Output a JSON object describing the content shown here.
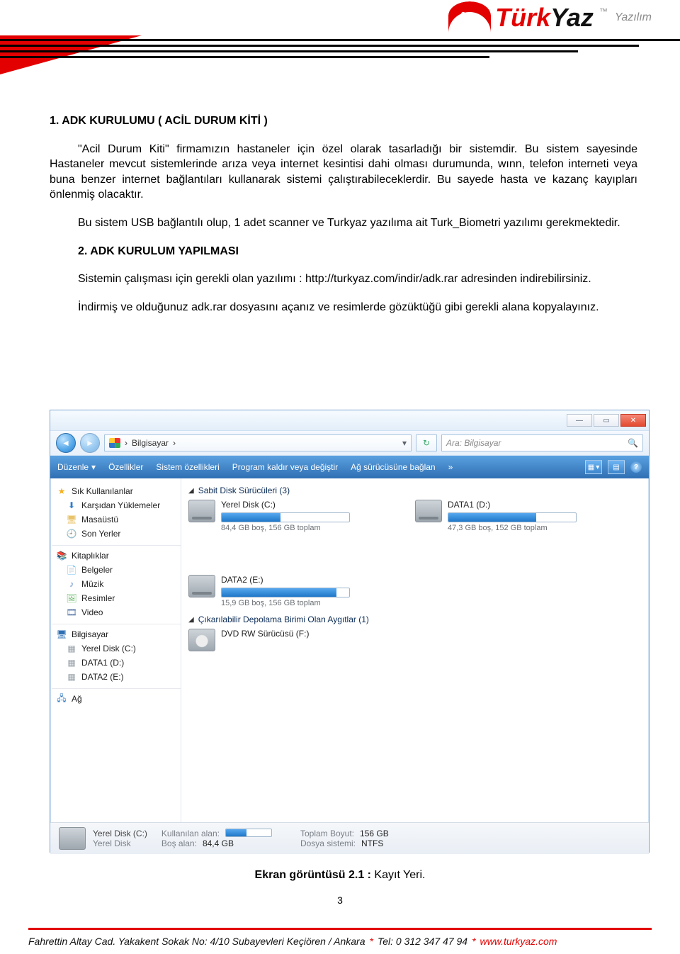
{
  "brand": {
    "part1": "Türk",
    "part2": "Yaz",
    "sub": "Yazılım"
  },
  "section1": {
    "title": "1.  ADK KURULUMU ( ACİL DURUM KİTİ )",
    "p1": "\"Acil Durum Kiti\" firmamızın hastaneler için özel olarak tasarladığı bir sistemdir. Bu sistem sayesinde Hastaneler mevcut sistemlerinde arıza veya internet kesintisi dahi olması durumunda, wınn, telefon interneti veya buna benzer internet bağlantıları kullanarak sistemi çalıştırabileceklerdir. Bu sayede hasta ve kazanç kayıpları önlenmiş olacaktır.",
    "p2": "Bu sistem USB bağlantılı olup, 1 adet scanner ve Turkyaz yazılıma ait Turk_Biometri yazılımı gerekmektedir."
  },
  "section2": {
    "title": "2.  ADK KURULUM YAPILMASI",
    "p1a": "Sistemin çalışması için gerekli olan yazılımı : ",
    "p1_link": "http://turkyaz.com/indir/adk.rar",
    "p1b": " adresinden indirebilirsiniz.",
    "p2": "İndirmiş ve olduğunuz adk.rar dosyasını açanız ve resimlerde gözüktüğü gibi gerekli alana kopyalayınız."
  },
  "explorer": {
    "breadcrumb": "Bilgisayar",
    "breadcrumb_sep": "›",
    "search_placeholder": "Ara: Bilgisayar",
    "toolbar": {
      "organize": "Düzenle",
      "properties": "Özellikler",
      "sysprops": "Sistem özellikleri",
      "uninstall": "Program kaldır veya değiştir",
      "mapdrive": "Ağ sürücüsüne bağlan",
      "more": "»"
    },
    "sidebar": {
      "favorites": "Sık Kullanılanlar",
      "downloads": "Karşıdan Yüklemeler",
      "desktop": "Masaüstü",
      "recent": "Son Yerler",
      "libraries": "Kitaplıklar",
      "documents": "Belgeler",
      "music": "Müzik",
      "pictures": "Resimler",
      "video": "Video",
      "computer": "Bilgisayar",
      "c": "Yerel Disk (C:)",
      "d": "DATA1 (D:)",
      "e": "DATA2 (E:)",
      "network": "Ağ"
    },
    "groups": {
      "hdd_header": "Sabit Disk Sürücüleri (3)",
      "removable_header": "Çıkarılabilir Depolama Birimi Olan Aygıtlar (1)"
    },
    "drives": {
      "c": {
        "name": "Yerel Disk (C:)",
        "sub": "84,4 GB boş, 156 GB toplam",
        "fill_pct": 46
      },
      "d": {
        "name": "DATA1 (D:)",
        "sub": "47,3 GB boş, 152 GB toplam",
        "fill_pct": 69
      },
      "e": {
        "name": "DATA2 (E:)",
        "sub": "15,9 GB boş, 156 GB toplam",
        "fill_pct": 90
      },
      "f": {
        "name": "DVD RW Sürücüsü (F:)"
      }
    },
    "status": {
      "title": "Yerel Disk (C:)",
      "type": "Yerel Disk",
      "used_label": "Kullanılan alan:",
      "free_label": "Boş alan:",
      "free_val": "84,4 GB",
      "total_label": "Toplam Boyut:",
      "total_val": "156 GB",
      "fs_label": "Dosya sistemi:",
      "fs_val": "NTFS",
      "mini_fill_pct": 46
    }
  },
  "caption": {
    "bold": "Ekran görüntüsü 2.1 :",
    "rest": " Kayıt Yeri."
  },
  "page_number": "3",
  "footer": {
    "addr": "Fahrettin Altay Cad. Yakakent Sokak No: 4/10 Subayevleri Keçiören / Ankara",
    "sep": "*",
    "tel": "Tel: 0 312 347 47 94",
    "url": "www.turkyaz.com"
  }
}
